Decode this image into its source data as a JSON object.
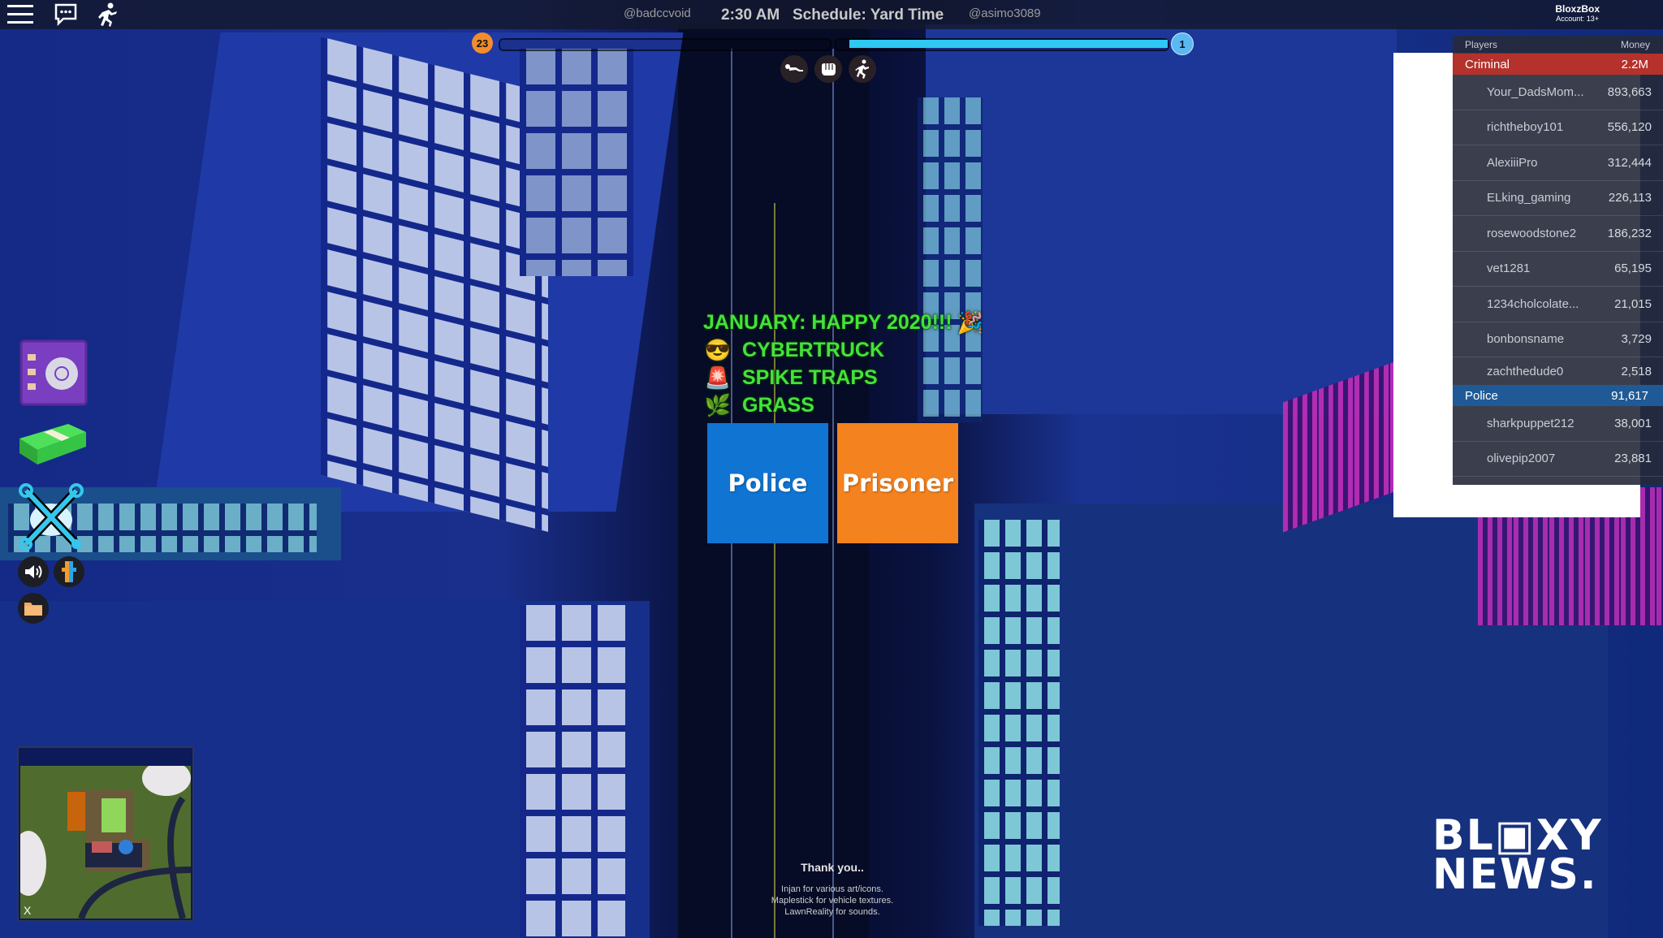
{
  "topbar": {
    "menu_icon": "hamburger-menu-icon",
    "chat_icon": "chat-bubble-icon",
    "emote_icon": "running-figure-icon",
    "left_username": "@badccvoid",
    "time": "2:30 AM",
    "schedule": "Schedule: Yard Time",
    "right_username": "@asimo3089",
    "account_name": "BloxzBox",
    "account_age": "Account: 13+"
  },
  "team_balance": {
    "prisoner_count": "23",
    "police_count": "1",
    "prisoner_color": "#f38d2c",
    "police_color": "#2ec8f2",
    "police_bar_fill_fraction": 0.96
  },
  "actions": [
    {
      "name": "crawl",
      "icon": "crawl-icon"
    },
    {
      "name": "punch",
      "icon": "fist-icon"
    },
    {
      "name": "run",
      "icon": "running-person-icon"
    }
  ],
  "announcement": {
    "title": "JANUARY: HAPPY 2020!!!",
    "title_icon": "party-popper-icon",
    "items": [
      {
        "emoji": "😎",
        "icon": "sunglasses-face-icon",
        "label": "CYBERTRUCK"
      },
      {
        "emoji": "🚨",
        "icon": "siren-light-icon",
        "label": "SPIKE TRAPS"
      },
      {
        "emoji": "🌿",
        "icon": "herb-icon",
        "label": "GRASS"
      }
    ],
    "color": "#44e23a"
  },
  "team_select": {
    "police_label": "Police",
    "prisoner_label": "Prisoner",
    "police_color": "#1074d3",
    "prisoner_color": "#f3821f"
  },
  "side_menu": [
    {
      "name": "vault",
      "icon": "safe-icon"
    },
    {
      "name": "shop",
      "icon": "cash-stack-icon"
    },
    {
      "name": "garage",
      "icon": "crossed-wrenches-icon"
    },
    {
      "name": "sound",
      "icon": "speaker-icon"
    },
    {
      "name": "team",
      "icon": "team-figure-icon"
    },
    {
      "name": "inventory",
      "icon": "folder-icon"
    }
  ],
  "minimap": {
    "close_label": "X"
  },
  "credits": {
    "title": "Thank you..",
    "lines": [
      "Injan for various art/icons.",
      "Maplestick for vehicle textures.",
      "LawnReality for sounds."
    ]
  },
  "leaderboard": {
    "header_players": "Players",
    "header_money": "Money",
    "teams": [
      {
        "name": "Criminal",
        "total": "2.2M",
        "color": "#b5312c",
        "players": [
          {
            "name": "Your_DadsMom...",
            "money": "893,663"
          },
          {
            "name": "richtheboy101",
            "money": "556,120"
          },
          {
            "name": "AlexiiiPro",
            "money": "312,444"
          },
          {
            "name": "ELking_gaming",
            "money": "226,113"
          },
          {
            "name": "rosewoodstone2",
            "money": "186,232"
          },
          {
            "name": "vet1281",
            "money": "65,195"
          },
          {
            "name": "1234cholcolate...",
            "money": "21,015"
          },
          {
            "name": "bonbonsname",
            "money": "3,729"
          },
          {
            "name": "zachthedude0",
            "money": "2,518"
          }
        ]
      },
      {
        "name": "Police",
        "total": "91,617",
        "color": "#1f5a96",
        "players": [
          {
            "name": "sharkpuppet212",
            "money": "38,001"
          },
          {
            "name": "olivepip2007",
            "money": "23,881"
          }
        ]
      }
    ]
  },
  "watermark": {
    "line1": "BL▣XY",
    "line2": "NEWS."
  }
}
